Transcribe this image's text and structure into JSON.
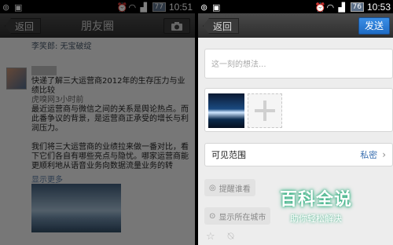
{
  "left_screen": {
    "status_time": "10:51",
    "battery": "77",
    "back_label": "返回",
    "title": "朋友圈",
    "cover_name": "李笑郎: 无宝破绽",
    "post": {
      "lines": [
        "快递了解三大运营商2012年的生存压力与业绩比较",
        "虎嗅网3小时前",
        "最近运营商与微信之间的关系是舆论热点。而此番争议的背景，是运营商正承受的增长与利润压力。",
        "",
        "我们将三大运营商的业绩拉来做一番对比，看下它们各自有哪些亮点与隐忧。哪家运营商能更顺利地从语音业务向数据流量业务的转"
      ],
      "more": "显示更多"
    }
  },
  "right_screen": {
    "status_time": "10:53",
    "battery": "76",
    "back_label": "返回",
    "send_label": "发送",
    "compose_placeholder": "这一刻的想法...",
    "visibility_label": "可见范围",
    "visibility_value": "私密",
    "remind_label": "提醒谁看",
    "location_label": "显示所在城市"
  },
  "watermark": {
    "title": "百科全说",
    "subtitle": "助你轻松解决"
  },
  "icons": [
    "camera-icon",
    "add-photo-icon",
    "chevron-right-icon",
    "at-icon",
    "location-icon",
    "star-icon",
    "privacy-icon"
  ],
  "colors": {
    "send_blue": "#2a7ad6",
    "link_blue": "#3a6fb0"
  }
}
